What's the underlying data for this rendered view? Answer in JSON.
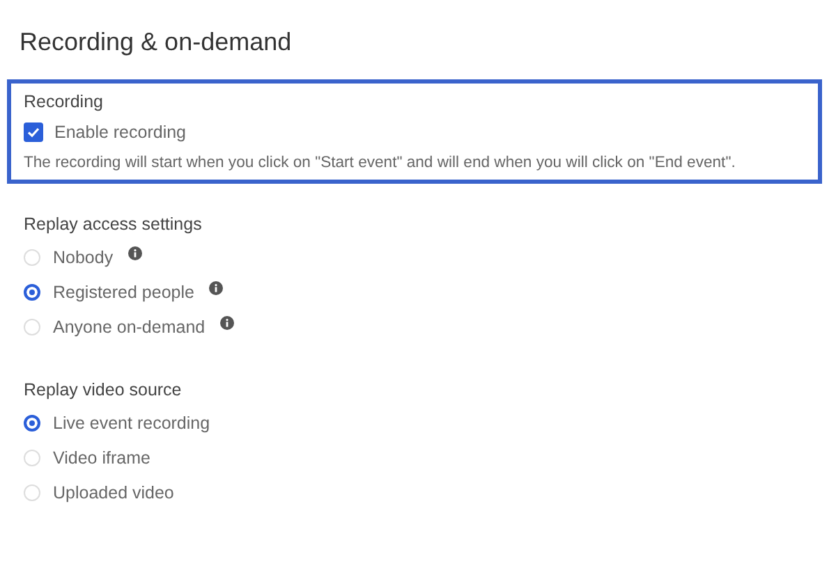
{
  "title": "Recording & on-demand",
  "recording": {
    "heading": "Recording",
    "highlighted": true,
    "checkbox": {
      "label": "Enable recording",
      "checked": true
    },
    "description": "The recording will start when you click on \"Start event\" and will end when you will click on \"End event\"."
  },
  "sections": [
    {
      "heading": "Replay access settings",
      "options": [
        {
          "label": "Nobody",
          "selected": false,
          "info": true
        },
        {
          "label": "Registered people",
          "selected": true,
          "info": true
        },
        {
          "label": "Anyone on-demand",
          "selected": false,
          "info": true
        }
      ]
    },
    {
      "heading": "Replay video source",
      "options": [
        {
          "label": "Live event recording",
          "selected": true,
          "info": false
        },
        {
          "label": "Video iframe",
          "selected": false,
          "info": false
        },
        {
          "label": "Uploaded video",
          "selected": false,
          "info": false
        }
      ]
    }
  ]
}
